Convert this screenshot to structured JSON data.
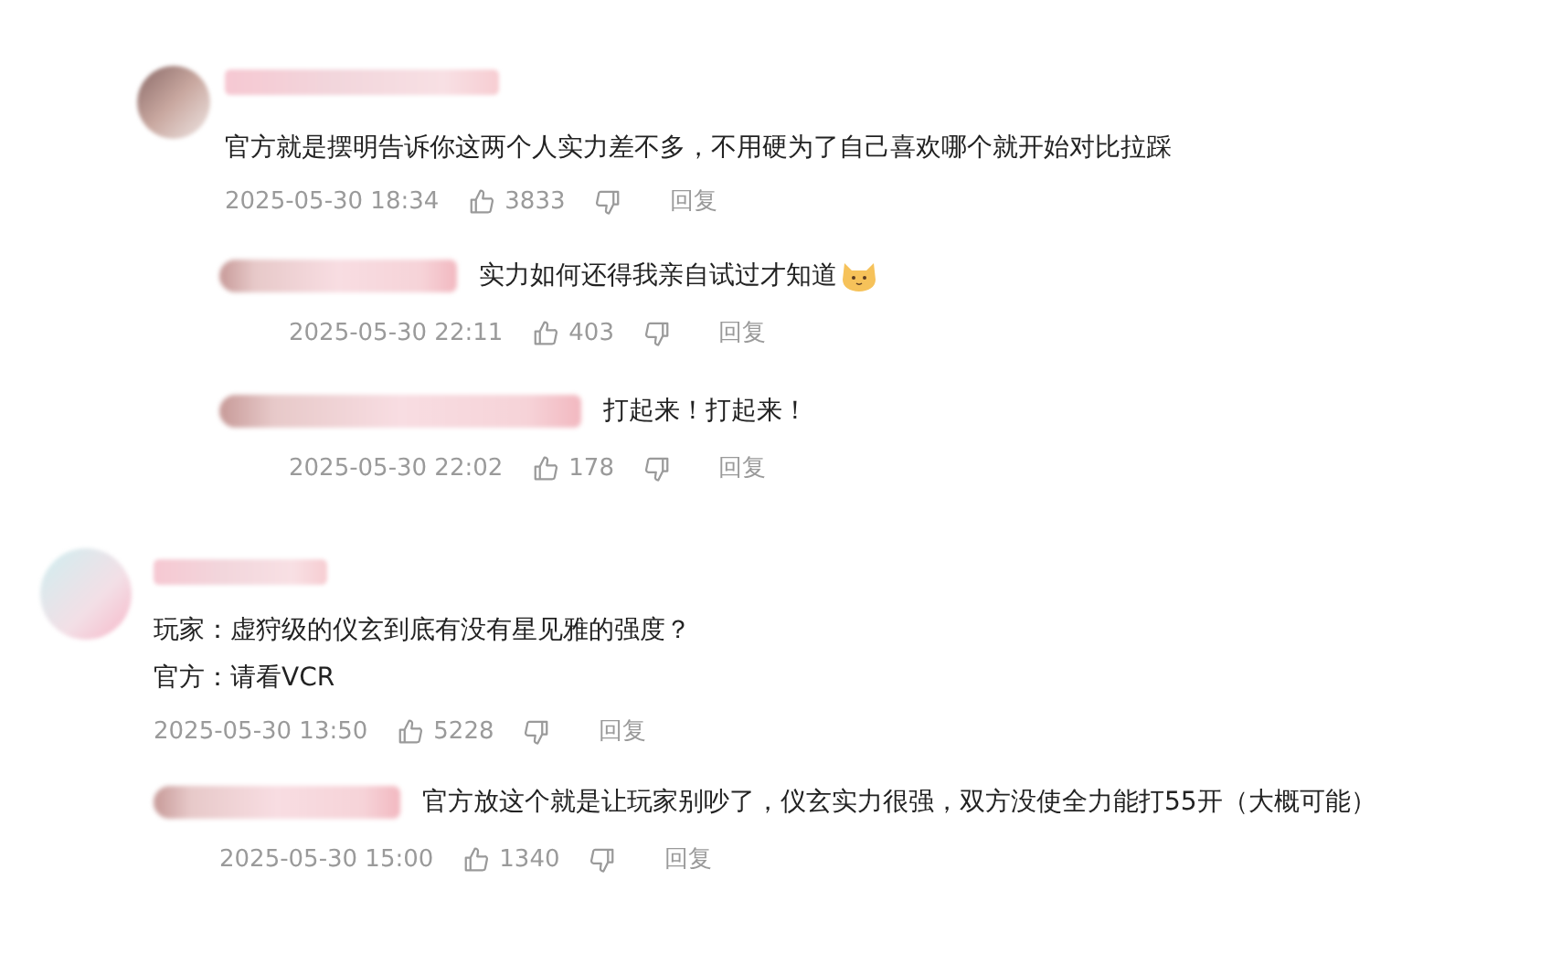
{
  "comments": [
    {
      "lines": [
        "官方就是摆明告诉你这两个人实力差不多，不用硬为了自己喜欢哪个就开始对比拉踩"
      ],
      "time": "2025-05-30 18:34",
      "likes": "3833",
      "reply_label": "回复",
      "replies": [
        {
          "text": "实力如何还得我亲自试过才知道",
          "has_emoji": true,
          "time": "2025-05-30 22:11",
          "likes": "403",
          "reply_label": "回复"
        },
        {
          "text": "打起来！打起来！",
          "has_emoji": false,
          "time": "2025-05-30 22:02",
          "likes": "178",
          "reply_label": "回复"
        }
      ]
    },
    {
      "lines": [
        "玩家：虚狩级的仪玄到底有没有星见雅的强度？",
        "官方：请看VCR"
      ],
      "time": "2025-05-30 13:50",
      "likes": "5228",
      "reply_label": "回复",
      "replies": [
        {
          "text": "官方放这个就是让玩家别吵了，仪玄实力很强，双方没使全力能打55开（大概可能）",
          "has_emoji": false,
          "time": "2025-05-30 15:00",
          "likes": "1340",
          "reply_label": "回复"
        }
      ]
    }
  ]
}
